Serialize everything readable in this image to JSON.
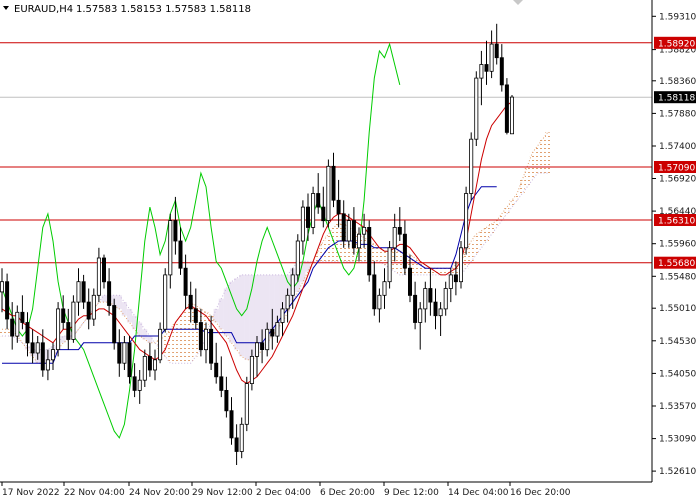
{
  "header": {
    "symbol": "EURAUD,H4",
    "ohlc": "1.57583 1.58153 1.57583 1.58118"
  },
  "colors": {
    "background": "#ffffff",
    "axis": "#000000",
    "candle": "#000000",
    "level": "#cc0000",
    "tenkan": "#cc0000",
    "kijun": "#0000aa",
    "chikou": "#00cc00",
    "cloud": "#e0a070",
    "cloud_alt": "#c8b4dc",
    "current_price_bg": "#000000"
  },
  "chart_data": {
    "type": "candlestick",
    "indicator": "Ichimoku",
    "ylim": [
      1.5245,
      1.5955
    ],
    "y_ticks": [
      "1.59310",
      "1.58820",
      "1.58360",
      "1.57880",
      "1.57400",
      "1.56920",
      "1.56440",
      "1.55960",
      "1.55480",
      "1.55010",
      "1.54530",
      "1.54050",
      "1.53570",
      "1.53090",
      "1.52610"
    ],
    "x_ticks": [
      "17 Nov 2022",
      "22 Nov 04:00",
      "24 Nov 20:00",
      "29 Nov 12:00",
      "2 Dec 04:00",
      "6 Dec 20:00",
      "9 Dec 12:00",
      "14 Dec 04:00",
      "16 Dec 20:00"
    ],
    "levels": [
      {
        "label": "1.58920",
        "value": 1.5892
      },
      {
        "label": "1.57090",
        "value": 1.5709
      },
      {
        "label": "1.56310",
        "value": 1.5631
      },
      {
        "label": "1.55680",
        "value": 1.5568
      }
    ],
    "current_price": {
      "label": "1.58118",
      "value": 1.58118
    },
    "candles": [
      [
        1.5525,
        1.556,
        1.5495,
        1.554
      ],
      [
        1.554,
        1.5552,
        1.547,
        1.5485
      ],
      [
        1.5485,
        1.551,
        1.544,
        1.546
      ],
      [
        1.546,
        1.5505,
        1.545,
        1.5495
      ],
      [
        1.5495,
        1.552,
        1.547,
        1.548
      ],
      [
        1.548,
        1.5495,
        1.543,
        1.545
      ],
      [
        1.545,
        1.547,
        1.542,
        1.5435
      ],
      [
        1.5435,
        1.546,
        1.5425,
        1.545
      ],
      [
        1.545,
        1.547,
        1.54,
        1.541
      ],
      [
        1.541,
        1.544,
        1.5395,
        1.5425
      ],
      [
        1.5425,
        1.545,
        1.541,
        1.544
      ],
      [
        1.544,
        1.551,
        1.543,
        1.55
      ],
      [
        1.55,
        1.552,
        1.547,
        1.548
      ],
      [
        1.548,
        1.55,
        1.544,
        1.5455
      ],
      [
        1.5455,
        1.552,
        1.545,
        1.551
      ],
      [
        1.551,
        1.556,
        1.549,
        1.554
      ],
      [
        1.554,
        1.555,
        1.55,
        1.551
      ],
      [
        1.551,
        1.553,
        1.547,
        1.5485
      ],
      [
        1.5485,
        1.553,
        1.5475,
        1.552
      ],
      [
        1.552,
        1.559,
        1.551,
        1.5575
      ],
      [
        1.5575,
        1.558,
        1.553,
        1.554
      ],
      [
        1.554,
        1.556,
        1.549,
        1.5505
      ],
      [
        1.5505,
        1.5515,
        1.544,
        1.545
      ],
      [
        1.545,
        1.547,
        1.54,
        1.542
      ],
      [
        1.542,
        1.546,
        1.541,
        1.545
      ],
      [
        1.545,
        1.546,
        1.539,
        1.54
      ],
      [
        1.54,
        1.542,
        1.537,
        1.538
      ],
      [
        1.538,
        1.541,
        1.536,
        1.5395
      ],
      [
        1.5395,
        1.544,
        1.5385,
        1.543
      ],
      [
        1.543,
        1.545,
        1.54,
        1.541
      ],
      [
        1.541,
        1.544,
        1.5395,
        1.5425
      ],
      [
        1.5425,
        1.548,
        1.542,
        1.547
      ],
      [
        1.547,
        1.556,
        1.5465,
        1.555
      ],
      [
        1.555,
        1.564,
        1.553,
        1.563
      ],
      [
        1.563,
        1.5665,
        1.558,
        1.56
      ],
      [
        1.56,
        1.562,
        1.555,
        1.556
      ],
      [
        1.556,
        1.558,
        1.55,
        1.552
      ],
      [
        1.552,
        1.554,
        1.548,
        1.55
      ],
      [
        1.55,
        1.553,
        1.547,
        1.548
      ],
      [
        1.548,
        1.55,
        1.543,
        1.544
      ],
      [
        1.544,
        1.548,
        1.542,
        1.547
      ],
      [
        1.547,
        1.549,
        1.541,
        1.542
      ],
      [
        1.542,
        1.545,
        1.539,
        1.54
      ],
      [
        1.54,
        1.543,
        1.537,
        1.538
      ],
      [
        1.538,
        1.54,
        1.534,
        1.535
      ],
      [
        1.535,
        1.537,
        1.53,
        1.531
      ],
      [
        1.531,
        1.533,
        1.527,
        1.529
      ],
      [
        1.529,
        1.534,
        1.528,
        1.533
      ],
      [
        1.533,
        1.54,
        1.532,
        1.539
      ],
      [
        1.539,
        1.544,
        1.538,
        1.543
      ],
      [
        1.543,
        1.546,
        1.54,
        1.545
      ],
      [
        1.545,
        1.547,
        1.542,
        1.544
      ],
      [
        1.544,
        1.548,
        1.543,
        1.547
      ],
      [
        1.547,
        1.55,
        1.544,
        1.546
      ],
      [
        1.546,
        1.549,
        1.545,
        1.548
      ],
      [
        1.548,
        1.551,
        1.546,
        1.55
      ],
      [
        1.55,
        1.553,
        1.548,
        1.552
      ],
      [
        1.552,
        1.556,
        1.55,
        1.555
      ],
      [
        1.555,
        1.561,
        1.554,
        1.56
      ],
      [
        1.56,
        1.566,
        1.558,
        1.565
      ],
      [
        1.565,
        1.567,
        1.56,
        1.562
      ],
      [
        1.562,
        1.568,
        1.561,
        1.567
      ],
      [
        1.567,
        1.57,
        1.564,
        1.565
      ],
      [
        1.565,
        1.568,
        1.562,
        1.563
      ],
      [
        1.563,
        1.572,
        1.562,
        1.571
      ],
      [
        1.571,
        1.573,
        1.565,
        1.566
      ],
      [
        1.566,
        1.569,
        1.562,
        1.564
      ],
      [
        1.564,
        1.566,
        1.559,
        1.56
      ],
      [
        1.56,
        1.564,
        1.559,
        1.563
      ],
      [
        1.563,
        1.565,
        1.558,
        1.559
      ],
      [
        1.559,
        1.562,
        1.557,
        1.561
      ],
      [
        1.561,
        1.564,
        1.559,
        1.562
      ],
      [
        1.562,
        1.563,
        1.554,
        1.555
      ],
      [
        1.555,
        1.557,
        1.549,
        1.55
      ],
      [
        1.55,
        1.553,
        1.548,
        1.552
      ],
      [
        1.552,
        1.556,
        1.55,
        1.554
      ],
      [
        1.554,
        1.56,
        1.553,
        1.559
      ],
      [
        1.559,
        1.564,
        1.557,
        1.562
      ],
      [
        1.562,
        1.565,
        1.56,
        1.561
      ],
      [
        1.561,
        1.563,
        1.555,
        1.556
      ],
      [
        1.556,
        1.558,
        1.551,
        1.552
      ],
      [
        1.552,
        1.554,
        1.547,
        1.548
      ],
      [
        1.548,
        1.551,
        1.544,
        1.55
      ],
      [
        1.55,
        1.554,
        1.548,
        1.553
      ],
      [
        1.553,
        1.556,
        1.549,
        1.551
      ],
      [
        1.551,
        1.553,
        1.547,
        1.549
      ],
      [
        1.549,
        1.551,
        1.546,
        1.55
      ],
      [
        1.55,
        1.554,
        1.549,
        1.553
      ],
      [
        1.553,
        1.556,
        1.551,
        1.555
      ],
      [
        1.555,
        1.557,
        1.552,
        1.554
      ],
      [
        1.554,
        1.56,
        1.553,
        1.559
      ],
      [
        1.559,
        1.568,
        1.558,
        1.567
      ],
      [
        1.567,
        1.576,
        1.566,
        1.575
      ],
      [
        1.575,
        1.585,
        1.574,
        1.584
      ],
      [
        1.584,
        1.588,
        1.58,
        1.586
      ],
      [
        1.586,
        1.5895,
        1.583,
        1.585
      ],
      [
        1.585,
        1.591,
        1.584,
        1.589
      ],
      [
        1.589,
        1.592,
        1.586,
        1.587
      ],
      [
        1.587,
        1.589,
        1.582,
        1.583
      ],
      [
        1.583,
        1.584,
        1.5757,
        1.576
      ],
      [
        1.5758,
        1.5815,
        1.5758,
        1.5812
      ]
    ],
    "tenkan": [
      1.55,
      1.5495,
      1.549,
      1.549,
      1.548,
      1.5475,
      1.547,
      1.5465,
      1.546,
      1.5455,
      1.545,
      1.546,
      1.547,
      1.547,
      1.5475,
      1.5485,
      1.549,
      1.549,
      1.5495,
      1.55,
      1.55,
      1.5495,
      1.549,
      1.548,
      1.547,
      1.546,
      1.545,
      1.544,
      1.5435,
      1.543,
      1.5425,
      1.543,
      1.544,
      1.546,
      1.548,
      1.549,
      1.55,
      1.5505,
      1.55,
      1.5495,
      1.549,
      1.548,
      1.547,
      1.546,
      1.545,
      1.543,
      1.541,
      1.5395,
      1.539,
      1.5395,
      1.54,
      1.541,
      1.542,
      1.543,
      1.5445,
      1.546,
      1.5475,
      1.549,
      1.551,
      1.553,
      1.555,
      1.557,
      1.559,
      1.561,
      1.5625,
      1.5635,
      1.564,
      1.564,
      1.5635,
      1.563,
      1.5625,
      1.562,
      1.561,
      1.56,
      1.559,
      1.5585,
      1.5585,
      1.559,
      1.5595,
      1.5595,
      1.559,
      1.558,
      1.557,
      1.5565,
      1.556,
      1.5555,
      1.555,
      1.555,
      1.5555,
      1.556,
      1.557,
      1.56,
      1.564,
      1.568,
      1.572,
      1.575,
      1.577,
      1.578,
      1.579,
      1.58,
      1.5805
    ],
    "kijun": [
      1.542,
      1.542,
      1.542,
      1.542,
      1.542,
      1.542,
      1.542,
      1.542,
      1.542,
      1.542,
      1.542,
      1.544,
      1.544,
      1.544,
      1.544,
      1.544,
      1.545,
      1.545,
      1.545,
      1.545,
      1.545,
      1.545,
      1.545,
      1.545,
      1.545,
      1.545,
      1.546,
      1.546,
      1.546,
      1.546,
      1.546,
      1.546,
      1.547,
      1.547,
      1.547,
      1.547,
      1.547,
      1.547,
      1.547,
      1.547,
      1.5465,
      1.5465,
      1.5465,
      1.5465,
      1.5465,
      1.5465,
      1.545,
      1.545,
      1.545,
      1.545,
      1.545,
      1.545,
      1.546,
      1.547,
      1.548,
      1.549,
      1.55,
      1.551,
      1.552,
      1.553,
      1.554,
      1.556,
      1.557,
      1.558,
      1.559,
      1.5595,
      1.56,
      1.56,
      1.56,
      1.56,
      1.5595,
      1.5595,
      1.5595,
      1.559,
      1.559,
      1.559,
      1.559,
      1.559,
      1.5585,
      1.558,
      1.5575,
      1.557,
      1.5565,
      1.556,
      1.556,
      1.556,
      1.556,
      1.556,
      1.556,
      1.558,
      1.561,
      1.564,
      1.566,
      1.567,
      1.568,
      1.568,
      1.568,
      1.568
    ],
    "chikou": [
      1.553,
      1.551,
      1.549,
      1.547,
      1.546,
      1.547,
      1.55,
      1.556,
      1.562,
      1.564,
      1.56,
      1.554,
      1.55,
      1.548,
      1.546,
      1.545,
      1.544,
      1.542,
      1.54,
      1.538,
      1.536,
      1.534,
      1.532,
      1.531,
      1.533,
      1.538,
      1.544,
      1.552,
      1.56,
      1.565,
      1.562,
      1.558,
      1.56,
      1.564,
      1.566,
      1.562,
      1.56,
      1.562,
      1.566,
      1.57,
      1.568,
      1.562,
      1.557,
      1.556,
      1.554,
      1.552,
      1.55,
      1.549,
      1.55,
      1.553,
      1.557,
      1.56,
      1.562,
      1.56,
      1.558,
      1.556,
      1.554,
      1.553,
      1.554,
      1.557,
      1.561,
      1.564,
      1.566,
      1.564,
      1.562,
      1.56,
      1.558,
      1.556,
      1.555,
      1.556,
      1.559,
      1.566,
      1.576,
      1.584,
      1.588,
      1.587,
      1.589,
      1.586,
      1.583
    ],
    "span_a": [
      1.547,
      1.547,
      1.547,
      1.546,
      1.545,
      1.544,
      1.543,
      1.542,
      1.542,
      1.542,
      1.543,
      1.544,
      1.545,
      1.5455,
      1.546,
      1.547,
      1.548,
      1.549,
      1.55,
      1.551,
      1.551,
      1.551,
      1.5505,
      1.55,
      1.549,
      1.548,
      1.547,
      1.546,
      1.5455,
      1.545,
      1.545,
      1.5455,
      1.546,
      1.547,
      1.548,
      1.549,
      1.55,
      1.551,
      1.5505,
      1.55,
      1.5495,
      1.549,
      1.548,
      1.547,
      1.546,
      1.545,
      1.544,
      1.543,
      1.5425,
      1.5425,
      1.543,
      1.544,
      1.545,
      1.546,
      1.547,
      1.548,
      1.5495,
      1.551,
      1.5525,
      1.554,
      1.5555,
      1.557,
      1.5585,
      1.56,
      1.561,
      1.562,
      1.5625,
      1.5625,
      1.562,
      1.5615,
      1.561,
      1.5605,
      1.56,
      1.5595,
      1.559,
      1.5585,
      1.5585,
      1.5585,
      1.5585,
      1.5585,
      1.558,
      1.5575,
      1.557,
      1.5565,
      1.556,
      1.556,
      1.556,
      1.556,
      1.556,
      1.5565,
      1.557,
      1.5585,
      1.56,
      1.561,
      1.5615,
      1.562,
      1.5625,
      1.563,
      1.564,
      1.565,
      1.566,
      1.567,
      1.569,
      1.571,
      1.573,
      1.574,
      1.575,
      1.576
    ],
    "span_b": [
      1.546,
      1.546,
      1.546,
      1.5455,
      1.545,
      1.5445,
      1.544,
      1.544,
      1.544,
      1.544,
      1.5445,
      1.545,
      1.546,
      1.546,
      1.546,
      1.547,
      1.548,
      1.549,
      1.55,
      1.551,
      1.552,
      1.552,
      1.552,
      1.552,
      1.551,
      1.55,
      1.549,
      1.548,
      1.547,
      1.546,
      1.545,
      1.544,
      1.543,
      1.542,
      1.542,
      1.542,
      1.542,
      1.542,
      1.543,
      1.544,
      1.546,
      1.548,
      1.55,
      1.5515,
      1.553,
      1.554,
      1.5545,
      1.555,
      1.555,
      1.555,
      1.555,
      1.555,
      1.555,
      1.555,
      1.555,
      1.555,
      1.555,
      1.556,
      1.557,
      1.557,
      1.557,
      1.557,
      1.557,
      1.557,
      1.557,
      1.557,
      1.557,
      1.557,
      1.557,
      1.557,
      1.557,
      1.557,
      1.557,
      1.557,
      1.557,
      1.5565,
      1.556,
      1.5555,
      1.555,
      1.555,
      1.555,
      1.555,
      1.555,
      1.555,
      1.555,
      1.555,
      1.555,
      1.555,
      1.555,
      1.555,
      1.555,
      1.556,
      1.557,
      1.558,
      1.559,
      1.56,
      1.561,
      1.562,
      1.563,
      1.564,
      1.565,
      1.566,
      1.567,
      1.568,
      1.569,
      1.57,
      1.57,
      1.57
    ]
  }
}
